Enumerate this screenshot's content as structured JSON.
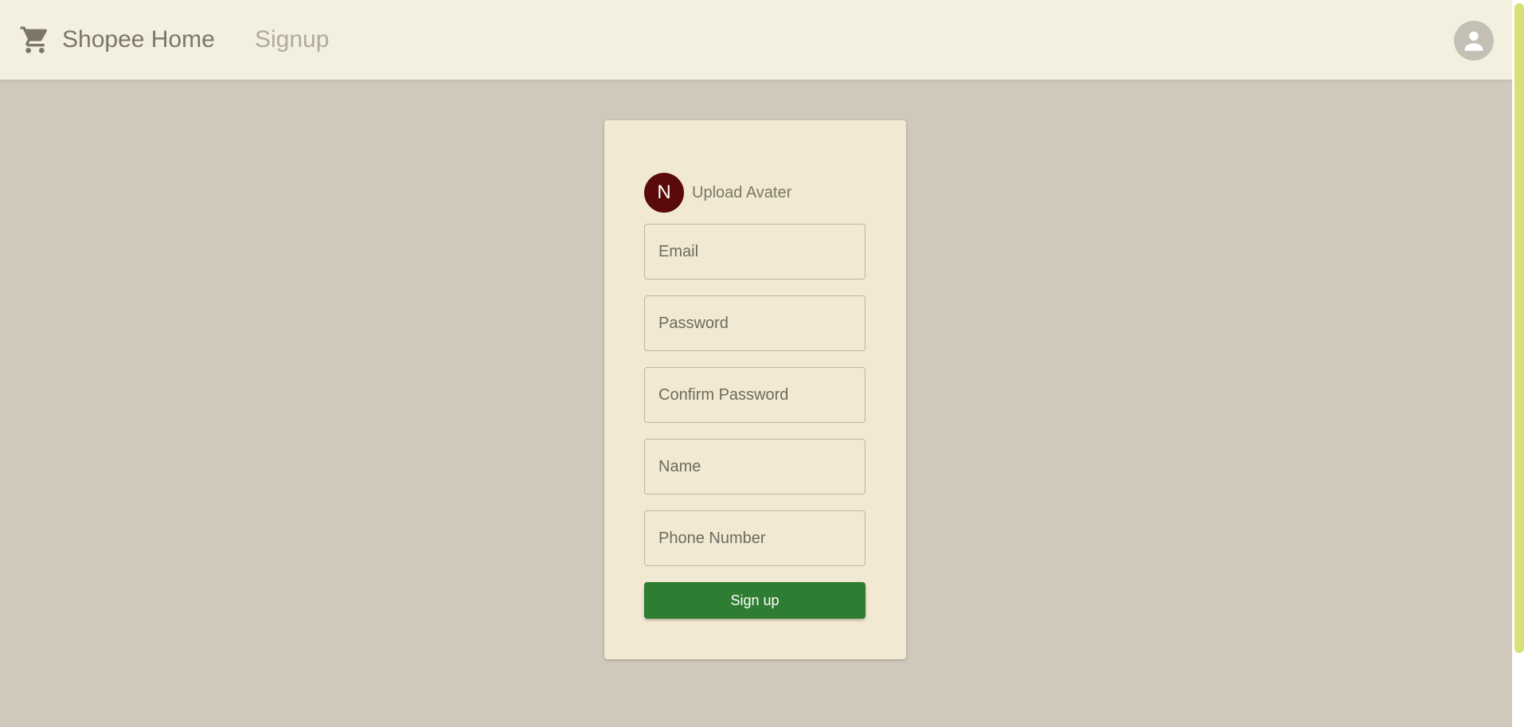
{
  "header": {
    "brand_icon": "shopping-cart-icon",
    "brand_label": "Shopee Home",
    "nav_signup": "Signup",
    "account_icon": "account-circle-icon"
  },
  "form": {
    "avatar_initial": "N",
    "upload_label": "Upload Avater",
    "email_placeholder": "Email",
    "password_placeholder": "Password",
    "confirm_password_placeholder": "Confirm Password",
    "name_placeholder": "Name",
    "phone_placeholder": "Phone Number",
    "submit_label": "Sign up"
  },
  "colors": {
    "appbar_bg": "#f3f0e0",
    "page_bg": "#d0c8ba",
    "card_bg": "#f1e9d1",
    "avatar_bg": "#5a0a0a",
    "primary_button": "#2e7d32"
  }
}
